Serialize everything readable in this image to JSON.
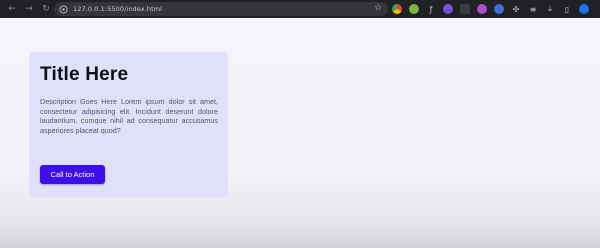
{
  "browser": {
    "url": "127.0.0.1:5500/index.html",
    "nav": [
      {
        "name": "back-icon",
        "glyph": "←"
      },
      {
        "name": "forward-icon",
        "glyph": "→"
      },
      {
        "name": "reload-icon",
        "glyph": "↻"
      }
    ],
    "site_icon": "site-info-icon",
    "bookmark_icon": "star-icon",
    "extensions": [
      {
        "name": "extension-icon-1",
        "color": "#5e97f6"
      },
      {
        "name": "extension-icon-2",
        "color": "#7cb342"
      },
      {
        "name": "extension-icon-3",
        "color": "#d0d0d0"
      },
      {
        "name": "extension-icon-4",
        "color": "#7b4fd8"
      },
      {
        "name": "extension-icon-5",
        "color": "#444"
      },
      {
        "name": "extension-icon-6",
        "color": "#8e44ad"
      },
      {
        "name": "extension-icon-7",
        "color": "#3b6fe0"
      },
      {
        "name": "puzzle-icon",
        "color": "#c8cacd"
      },
      {
        "name": "tab-search-icon",
        "color": "#c8cacd"
      },
      {
        "name": "download-icon",
        "color": "#c8cacd"
      },
      {
        "name": "profile-avatar",
        "color": "#1a73e8"
      }
    ]
  },
  "card": {
    "title": "Title Here",
    "description": "Description Goes Here Lorem ipsum dolor sit amet, consectetur adipisicing elit. Incidunt deserunt dolore laudantium, cumque nihil ad consequatur accusamus asperiores placeat quod?",
    "cta_label": "Call to Action",
    "cta_color": "#3d10e8",
    "background_color": "#e1e0fb"
  }
}
